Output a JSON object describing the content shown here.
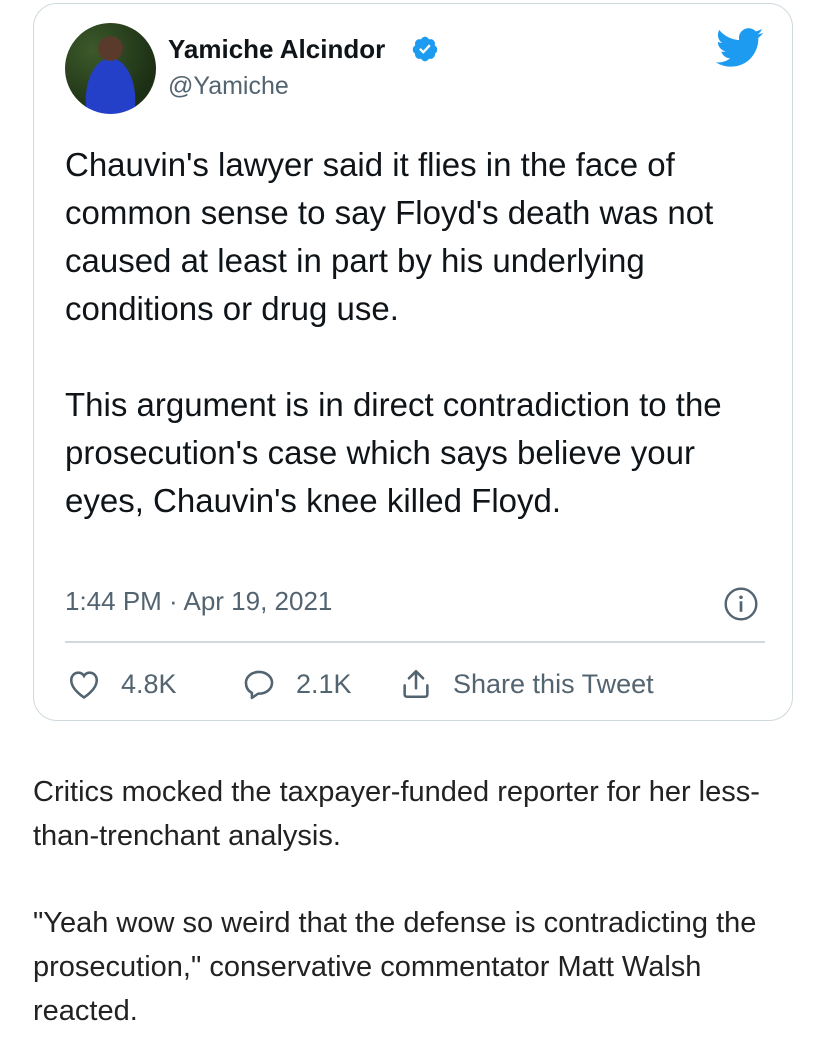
{
  "tweet": {
    "author_name": "Yamiche Alcindor",
    "handle": "@Yamiche",
    "paragraphs": [
      "Chauvin's lawyer said it flies in the face of common sense to say Floyd's death was not caused at least in part by his underlying conditions or drug use.",
      "This argument is in direct contradiction to the prosecution's case which says believe your eyes, Chauvin's knee killed Floyd."
    ],
    "timestamp": "1:44 PM · Apr 19, 2021",
    "likes": "4.8K",
    "replies": "2.1K",
    "share_label": "Share this Tweet"
  },
  "article": {
    "paragraphs": [
      "Critics mocked the taxpayer-funded reporter for her less-than-trenchant analysis.",
      "\"Yeah wow so weird that the defense is contradicting the prosecution,\" conservative commentator Matt Walsh reacted."
    ]
  },
  "icons": {
    "verified": "verified-badge-icon",
    "bird": "twitter-bird-icon",
    "info": "info-icon",
    "like": "heart-icon",
    "reply": "speech-bubble-icon",
    "share": "share-icon"
  },
  "colors": {
    "twitter_blue": "#1d9bf0",
    "secondary_text": "#536471",
    "border": "#cfd9de"
  }
}
